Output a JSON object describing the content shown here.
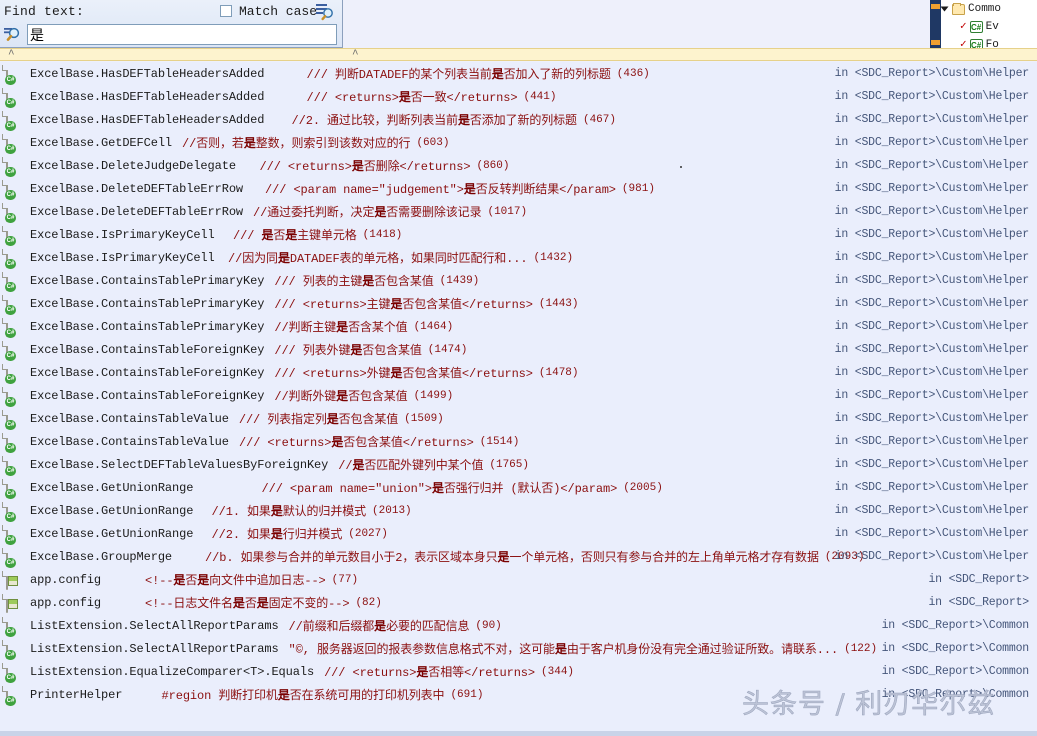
{
  "find_dialog": {
    "label": "Find text:",
    "match_case_label": "Match case",
    "match_case_checked": false,
    "input_value": "是",
    "input_placeholder": "",
    "search_icon": "search-magnifier-icon",
    "options_icon": "find-options-icon"
  },
  "collapse_strip": {
    "left_chevron": "^",
    "right_chevron": "^"
  },
  "background_tree": {
    "rows": [
      {
        "indent": 0,
        "expander": "collapse-triangle",
        "icon": "folder-icon",
        "label": "Commo"
      },
      {
        "indent": 1,
        "expander": "",
        "icon": "csharp-file-icon",
        "check": "✓",
        "label": "Ev"
      },
      {
        "indent": 1,
        "expander": "",
        "icon": "csharp-file-icon",
        "check": "✓",
        "label": "Fo"
      }
    ]
  },
  "results": {
    "rows": [
      {
        "icon": "csharp-file-icon",
        "member": "ExcelBase.HasDEFTableHeadersAdded",
        "comment": "///  判断DATADEF的某个列表当前是否加入了新的列标题",
        "line": "(436)",
        "path": "in <SDC_Report>\\Custom\\Helper"
      },
      {
        "icon": "csharp-file-icon",
        "member": "ExcelBase.HasDEFTableHeadersAdded",
        "comment": "///  <returns>是否一致</returns>",
        "line": "(441)",
        "path": "in <SDC_Report>\\Custom\\Helper"
      },
      {
        "icon": "csharp-file-icon",
        "member": "ExcelBase.HasDEFTableHeadersAdded",
        "comment": "//2. 通过比较，判断列表当前是否添加了新的列标题",
        "line": "(467)",
        "path": "in <SDC_Report>\\Custom\\Helper"
      },
      {
        "icon": "csharp-file-icon",
        "member": "ExcelBase.GetDEFCell",
        "comment": "//否则，若是整数，则索引到该数对应的行",
        "line": "(603)",
        "path": "in <SDC_Report>\\Custom\\Helper"
      },
      {
        "icon": "csharp-file-icon",
        "member": "ExcelBase.DeleteJudgeDelegate",
        "comment": "///  <returns>是否删除</returns>",
        "line": "(860)",
        "path": "in <SDC_Report>\\Custom\\Helper"
      },
      {
        "icon": "csharp-file-icon",
        "member": "ExcelBase.DeleteDEFTableErrRow",
        "comment": "///  <param name=\"judgement\">是否反转判断结果</param>",
        "line": "(981)",
        "path": "in <SDC_Report>\\Custom\\Helper"
      },
      {
        "icon": "csharp-file-icon",
        "member": "ExcelBase.DeleteDEFTableErrRow",
        "comment": "//通过委托判断，决定是否需要删除该记录",
        "line": "(1017)",
        "path": "in <SDC_Report>\\Custom\\Helper"
      },
      {
        "icon": "csharp-file-icon",
        "member": "ExcelBase.IsPrimaryKeyCell",
        "comment": "///  是否是主键单元格",
        "line": "(1418)",
        "path": "in <SDC_Report>\\Custom\\Helper"
      },
      {
        "icon": "csharp-file-icon",
        "member": "ExcelBase.IsPrimaryKeyCell",
        "comment": "//因为同是DATADEF表的单元格，如果同时匹配行和...",
        "line": "(1432)",
        "path": "in <SDC_Report>\\Custom\\Helper"
      },
      {
        "icon": "csharp-file-icon",
        "member": "ExcelBase.ContainsTablePrimaryKey",
        "comment": "///  列表的主键是否包含某值",
        "line": "(1439)",
        "path": "in <SDC_Report>\\Custom\\Helper"
      },
      {
        "icon": "csharp-file-icon",
        "member": "ExcelBase.ContainsTablePrimaryKey",
        "comment": "///  <returns>主键是否包含某值</returns>",
        "line": "(1443)",
        "path": "in <SDC_Report>\\Custom\\Helper"
      },
      {
        "icon": "csharp-file-icon",
        "member": "ExcelBase.ContainsTablePrimaryKey",
        "comment": "//判断主键是否含某个值",
        "line": "(1464)",
        "path": "in <SDC_Report>\\Custom\\Helper"
      },
      {
        "icon": "csharp-file-icon",
        "member": "ExcelBase.ContainsTableForeignKey",
        "comment": "///  列表外键是否包含某值",
        "line": "(1474)",
        "path": "in <SDC_Report>\\Custom\\Helper"
      },
      {
        "icon": "csharp-file-icon",
        "member": "ExcelBase.ContainsTableForeignKey",
        "comment": "///  <returns>外键是否包含某值</returns>",
        "line": "(1478)",
        "path": "in <SDC_Report>\\Custom\\Helper"
      },
      {
        "icon": "csharp-file-icon",
        "member": "ExcelBase.ContainsTableForeignKey",
        "comment": "//判断外键是否包含某值",
        "line": "(1499)",
        "path": "in <SDC_Report>\\Custom\\Helper"
      },
      {
        "icon": "csharp-file-icon",
        "member": "ExcelBase.ContainsTableValue",
        "comment": "///  列表指定列是否包含某值",
        "line": "(1509)",
        "path": "in <SDC_Report>\\Custom\\Helper"
      },
      {
        "icon": "csharp-file-icon",
        "member": "ExcelBase.ContainsTableValue",
        "comment": "///  <returns>是否包含某值</returns>",
        "line": "(1514)",
        "path": "in <SDC_Report>\\Custom\\Helper"
      },
      {
        "icon": "csharp-file-icon",
        "member": "ExcelBase.SelectDEFTableValuesByForeignKey",
        "comment": "//是否匹配外键列中某个值",
        "line": "(1765)",
        "path": "in <SDC_Report>\\Custom\\Helper"
      },
      {
        "icon": "csharp-file-icon",
        "member": "ExcelBase.GetUnionRange",
        "comment": "///  <param name=\"union\">是否强行归并 (默认否)</param>",
        "line": "(2005)",
        "path": "in <SDC_Report>\\Custom\\Helper"
      },
      {
        "icon": "csharp-file-icon",
        "member": "ExcelBase.GetUnionRange",
        "comment": "//1. 如果是默认的归并模式",
        "line": "(2013)",
        "path": "in <SDC_Report>\\Custom\\Helper"
      },
      {
        "icon": "csharp-file-icon",
        "member": "ExcelBase.GetUnionRange",
        "comment": "//2. 如果是行归并模式",
        "line": "(2027)",
        "path": "in <SDC_Report>\\Custom\\Helper"
      },
      {
        "icon": "csharp-file-icon",
        "member": "ExcelBase.GroupMerge",
        "comment": "//b. 如果参与合并的单元数目小于2，表示区域本身只是一个单元格，否则只有参与合并的左上角单元格才存有数据",
        "line": "(2093)",
        "path": "in <SDC_Report>\\Custom\\Helper"
      },
      {
        "icon": "config-file-icon",
        "member": "app.config",
        "comment": "<!--是否是向文件中追加日志-->",
        "line": "(77)",
        "path": "in <SDC_Report>"
      },
      {
        "icon": "config-file-icon",
        "member": "app.config",
        "comment": "<!--日志文件名是否是固定不变的-->",
        "line": "(82)",
        "path": "in <SDC_Report>"
      },
      {
        "icon": "csharp-file-icon",
        "member": "ListExtension.SelectAllReportParams",
        "comment": "//前缀和后缀都是必要的匹配信息",
        "line": "(90)",
        "path": "in <SDC_Report>\\Common"
      },
      {
        "icon": "csharp-file-icon",
        "member": "ListExtension.SelectAllReportParams",
        "comment": "\"©, 服务器返回的报表参数信息格式不对，这可能是由于客户机身份没有完全通过验证所致。请联系...",
        "line": "(122)",
        "path": "in <SDC_Report>\\Common"
      },
      {
        "icon": "csharp-file-icon",
        "member": "ListExtension.EqualizeComparer<T>.Equals",
        "comment": "///  <returns>是否相等</returns>",
        "line": "(344)",
        "path": "in <SDC_Report>\\Common"
      },
      {
        "icon": "csharp-file-icon",
        "member": "PrinterHelper",
        "comment": "#region 判断打印机是否在系统可用的打印机列表中",
        "line": "(691)",
        "path": "in <SDC_Report>\\Common"
      }
    ]
  },
  "watermark": {
    "text": "头条号 / 利刃华尔兹"
  },
  "colors": {
    "comment_red": "#8b0f0f",
    "path_blue": "#45567a",
    "list_bg": "#eaeefc",
    "strip_yellow": "#fdf3ce"
  }
}
